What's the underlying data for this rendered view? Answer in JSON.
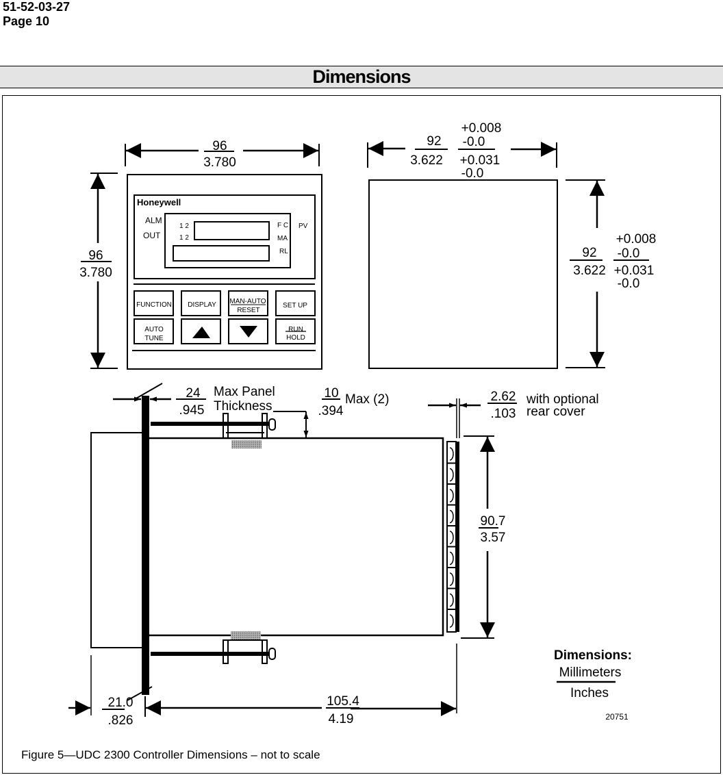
{
  "header": {
    "document_number": "51-52-03-27",
    "page": "Page 10"
  },
  "section_title": "Dimensions",
  "front_view": {
    "width_mm": "96",
    "width_in": "3.780",
    "height_mm": "96",
    "height_in": "3.780",
    "brand": "Honeywell",
    "indicators": {
      "alm": "ALM",
      "out": "OUT",
      "alm_nums": "1 2",
      "out_nums": "1 2",
      "fc": "F C",
      "ma": "MA",
      "rl": "RL",
      "pv": "PV"
    },
    "keys": [
      {
        "id": "function",
        "label": "FUNCTION"
      },
      {
        "id": "display",
        "label": "DISPLAY"
      },
      {
        "id": "man-auto-reset",
        "label_top": "MAN-AUTO",
        "label_bottom": "RESET"
      },
      {
        "id": "setup",
        "label": "SET UP"
      },
      {
        "id": "auto-tune",
        "label_top": "AUTO",
        "label_bottom": "TUNE"
      },
      {
        "id": "up",
        "icon": "up-triangle"
      },
      {
        "id": "down",
        "icon": "down-triangle"
      },
      {
        "id": "run-hold",
        "label_top": "RUN",
        "label_bottom": "HOLD"
      }
    ]
  },
  "panel_cutout": {
    "width_mm": "92",
    "width_in": "3.622",
    "width_tol_mm_plus": "+0.008",
    "width_tol_mm_minus": "-0.0",
    "width_tol_in_plus": "+0.031",
    "width_tol_in_minus": "-0.0",
    "height_mm": "92",
    "height_in": "3.622",
    "height_tol_mm_plus": "+0.008",
    "height_tol_mm_minus": "-0.0",
    "height_tol_in_plus": "+0.031",
    "height_tol_in_minus": "-0.0"
  },
  "side_view": {
    "panel_thickness_mm": "24",
    "panel_thickness_in": ".945",
    "panel_thickness_label_1": "Max Panel",
    "panel_thickness_label_2": "Thickness",
    "clamp_mm": "10",
    "clamp_in": ".394",
    "clamp_label": "Max (2)",
    "rear_cover_mm": "2.62",
    "rear_cover_in": ".103",
    "rear_cover_label_1": "with  optional",
    "rear_cover_label_2": "rear cover",
    "rear_height_mm": "90.7",
    "rear_height_in": "3.57",
    "bezel_depth_mm": "21.0",
    "bezel_depth_in": ".826",
    "body_depth_mm": "105.4",
    "body_depth_in": "4.19"
  },
  "legend": {
    "title": "Dimensions:",
    "top": "Millimeters",
    "bottom": "Inches",
    "drawing_number": "20751"
  },
  "caption": "Figure 5—UDC 2300 Controller Dimensions – not to scale"
}
